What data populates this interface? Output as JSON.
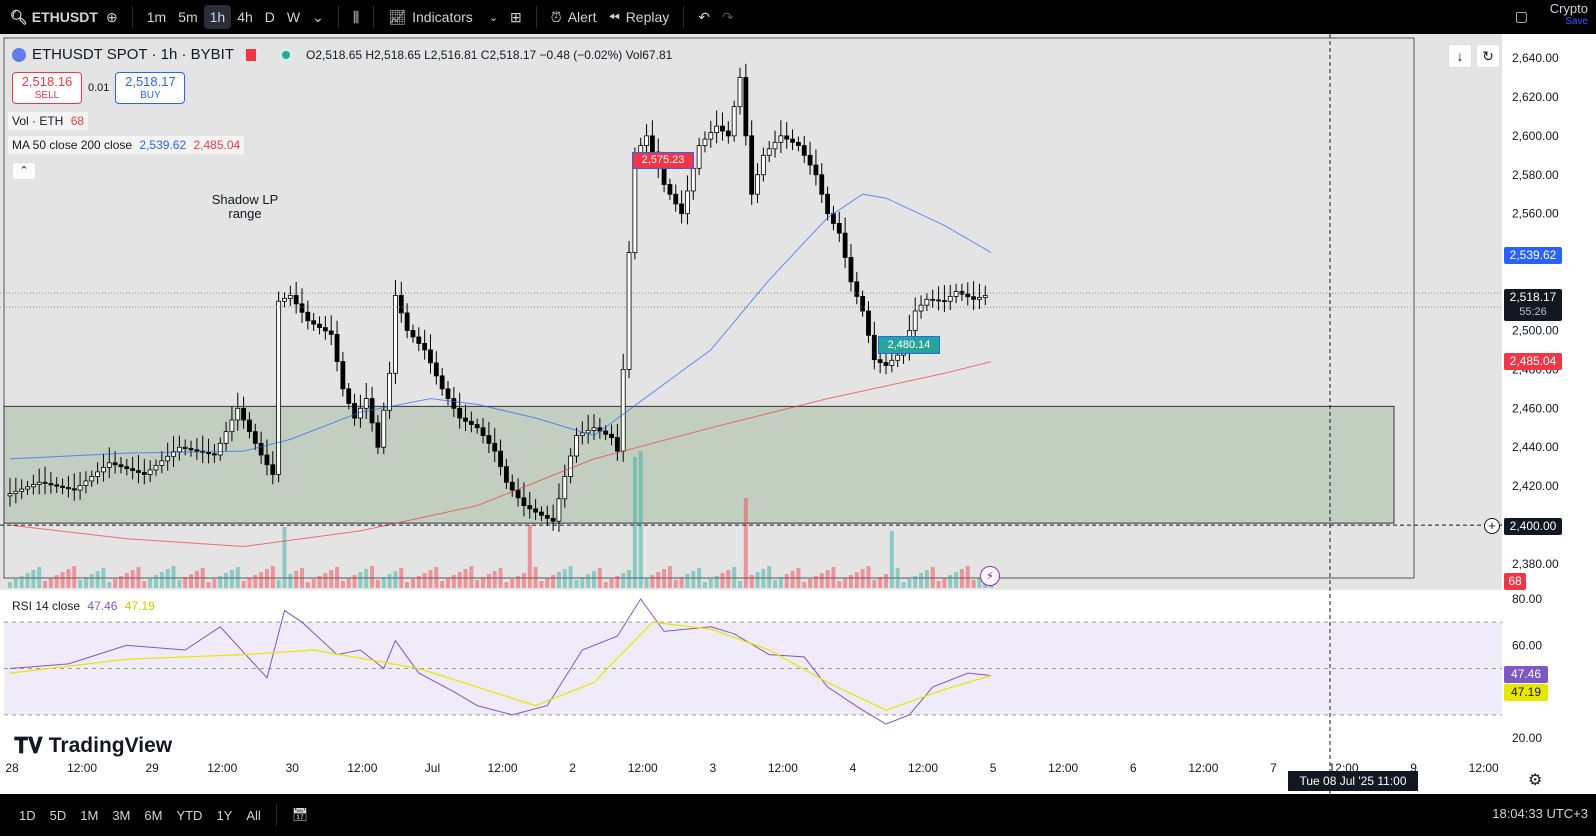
{
  "toolbar": {
    "symbol": "ETHUSDT",
    "intervals": [
      "1m",
      "5m",
      "1h",
      "4h",
      "D",
      "W"
    ],
    "active_interval": "1h",
    "indicators_label": "Indicators",
    "alert_label": "Alert",
    "replay_label": "Replay",
    "market_label": "Crypto",
    "save_label": "Save"
  },
  "legend": {
    "title": "ETHUSDT SPOT · 1h · BYBIT",
    "ohlc": "O2,518.65  H2,518.65  L2,516.81  C2,518.17  −0.48 (−0.02%)  Vol67.81",
    "sell_price": "2,518.16",
    "sell_label": "SELL",
    "spread": "0.01",
    "buy_price": "2,518.17",
    "buy_label": "BUY",
    "vol_label": "Vol · ETH",
    "vol_value": "68",
    "ma_label": "MA 50 close 200 close",
    "ma50_value": "2,539.62",
    "ma200_value": "2,485.04",
    "rsi_label": "RSI 14 close",
    "rsi_value": "47.46",
    "rsi_ma_value": "47.19"
  },
  "annotation": {
    "line1": "Shadow LP",
    "line2": "range"
  },
  "price_labels": {
    "ma50": "2,539.62",
    "last": "2,518.17",
    "countdown": "55:26",
    "ma200": "2,485.04",
    "cursor": "2,400.00",
    "volume": "68",
    "rsi": "47.46",
    "rsi_ma": "47.19",
    "high_marker": "2,575.23",
    "low_marker": "2,480.14"
  },
  "cursor_time": "Tue 08 Jul '25   11:00",
  "watermark": "TradingView",
  "ranges": [
    "1D",
    "5D",
    "1M",
    "3M",
    "6M",
    "YTD",
    "1Y",
    "All"
  ],
  "clock": "18:04:33 UTC+3",
  "colors": {
    "up": "#26a69a",
    "down": "#f23645",
    "ma50": "#2962ff",
    "ma200": "#f23645",
    "rsi": "#7e57c2",
    "rsi_ma": "#e6e600",
    "zone": "#b9c9b6"
  },
  "chart_data": {
    "type": "candlestick",
    "price_axis": [
      "2,640.00",
      "2,620.00",
      "2,600.00",
      "2,580.00",
      "2,560.00",
      "2,500.00",
      "2,480.00",
      "2,460.00",
      "2,440.00",
      "2,420.00",
      "2,380.00"
    ],
    "price_axis_values": [
      2640,
      2620,
      2600,
      2580,
      2560,
      2500,
      2480,
      2460,
      2440,
      2420,
      2380
    ],
    "time_axis": [
      "28",
      "12:00",
      "29",
      "12:00",
      "30",
      "12:00",
      "Jul",
      "12:00",
      "2",
      "12:00",
      "3",
      "12:00",
      "4",
      "12:00",
      "5",
      "12:00",
      "6",
      "12:00",
      "7",
      "12:00",
      "9",
      "12:00"
    ],
    "rsi_axis": [
      "80.00",
      "60.00",
      "20.00"
    ],
    "rsi_axis_values": [
      80,
      60,
      20
    ],
    "rsi_levels": [
      70,
      50,
      30
    ],
    "zone": {
      "from": 2401,
      "to": 2461
    },
    "cursor_price": 2400,
    "close_path": [
      [
        0,
        2415
      ],
      [
        6,
        2422
      ],
      [
        12,
        2418
      ],
      [
        18,
        2432
      ],
      [
        24,
        2426
      ],
      [
        30,
        2440
      ],
      [
        36,
        2436
      ],
      [
        40,
        2460
      ],
      [
        44,
        2436
      ],
      [
        46,
        2426
      ],
      [
        47,
        2515
      ],
      [
        49,
        2518
      ],
      [
        52,
        2505
      ],
      [
        56,
        2498
      ],
      [
        58,
        2470
      ],
      [
        60,
        2455
      ],
      [
        62,
        2465
      ],
      [
        64,
        2440
      ],
      [
        66,
        2478
      ],
      [
        67,
        2518
      ],
      [
        69,
        2500
      ],
      [
        72,
        2490
      ],
      [
        75,
        2470
      ],
      [
        78,
        2455
      ],
      [
        81,
        2450
      ],
      [
        84,
        2438
      ],
      [
        86,
        2422
      ],
      [
        89,
        2410
      ],
      [
        92,
        2405
      ],
      [
        94,
        2402
      ],
      [
        96,
        2425
      ],
      [
        98,
        2446
      ],
      [
        101,
        2450
      ],
      [
        104,
        2445
      ],
      [
        105,
        2438
      ],
      [
        106,
        2480
      ],
      [
        107,
        2540
      ],
      [
        108,
        2590
      ],
      [
        110,
        2600
      ],
      [
        113,
        2575
      ],
      [
        116,
        2560
      ],
      [
        119,
        2595
      ],
      [
        122,
        2605
      ],
      [
        124,
        2600
      ],
      [
        126,
        2630
      ],
      [
        128,
        2570
      ],
      [
        130,
        2590
      ],
      [
        133,
        2600
      ],
      [
        136,
        2595
      ],
      [
        139,
        2580
      ],
      [
        141,
        2560
      ],
      [
        143,
        2550
      ],
      [
        145,
        2525
      ],
      [
        147,
        2510
      ],
      [
        149,
        2485
      ],
      [
        151,
        2482
      ],
      [
        154,
        2490
      ],
      [
        156,
        2510
      ],
      [
        158,
        2516
      ],
      [
        161,
        2515
      ],
      [
        163,
        2520
      ],
      [
        166,
        2516
      ],
      [
        168,
        2518
      ]
    ],
    "ma50_path": [
      [
        0,
        2434
      ],
      [
        20,
        2437
      ],
      [
        40,
        2438
      ],
      [
        48,
        2444
      ],
      [
        60,
        2458
      ],
      [
        72,
        2465
      ],
      [
        80,
        2462
      ],
      [
        90,
        2455
      ],
      [
        100,
        2446
      ],
      [
        110,
        2468
      ],
      [
        120,
        2490
      ],
      [
        130,
        2526
      ],
      [
        140,
        2558
      ],
      [
        146,
        2570
      ],
      [
        150,
        2568
      ],
      [
        160,
        2554
      ],
      [
        168,
        2540
      ]
    ],
    "ma200_path": [
      [
        0,
        2400
      ],
      [
        20,
        2393
      ],
      [
        40,
        2389
      ],
      [
        60,
        2397
      ],
      [
        80,
        2410
      ],
      [
        100,
        2434
      ],
      [
        120,
        2450
      ],
      [
        140,
        2465
      ],
      [
        160,
        2478
      ],
      [
        168,
        2484
      ]
    ],
    "rsi_path": [
      [
        0,
        50
      ],
      [
        10,
        52
      ],
      [
        20,
        60
      ],
      [
        30,
        58
      ],
      [
        36,
        68
      ],
      [
        44,
        46
      ],
      [
        47,
        75
      ],
      [
        50,
        70
      ],
      [
        56,
        56
      ],
      [
        60,
        58
      ],
      [
        64,
        50
      ],
      [
        66,
        62
      ],
      [
        70,
        48
      ],
      [
        76,
        40
      ],
      [
        80,
        34
      ],
      [
        86,
        30
      ],
      [
        92,
        34
      ],
      [
        98,
        58
      ],
      [
        104,
        64
      ],
      [
        108,
        80
      ],
      [
        112,
        66
      ],
      [
        120,
        68
      ],
      [
        124,
        65
      ],
      [
        130,
        56
      ],
      [
        136,
        55
      ],
      [
        140,
        42
      ],
      [
        146,
        32
      ],
      [
        150,
        26
      ],
      [
        154,
        30
      ],
      [
        158,
        42
      ],
      [
        164,
        48
      ],
      [
        168,
        47
      ]
    ],
    "rsi_ma_path": [
      [
        0,
        48
      ],
      [
        20,
        54
      ],
      [
        40,
        56
      ],
      [
        52,
        58
      ],
      [
        70,
        50
      ],
      [
        90,
        34
      ],
      [
        100,
        44
      ],
      [
        110,
        70
      ],
      [
        120,
        67
      ],
      [
        130,
        58
      ],
      [
        140,
        44
      ],
      [
        150,
        32
      ],
      [
        160,
        41
      ],
      [
        168,
        47
      ]
    ],
    "volume_spikes": [
      [
        47,
        50
      ],
      [
        89,
        45
      ],
      [
        107,
        110
      ],
      [
        108,
        130
      ],
      [
        126,
        80
      ],
      [
        151,
        40
      ]
    ]
  }
}
